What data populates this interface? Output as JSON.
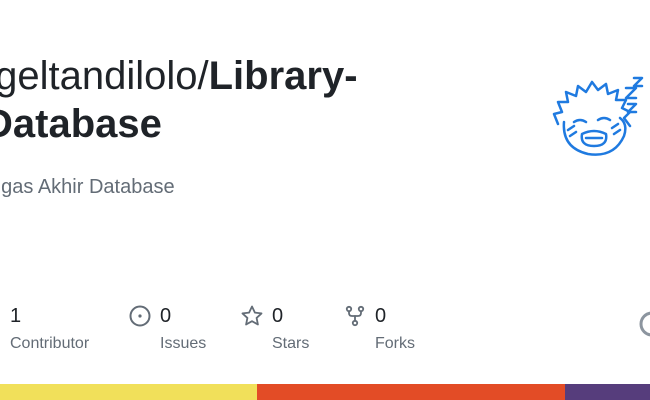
{
  "repo": {
    "owner": "Igeltandilolo",
    "separator": "/",
    "name_part1": "Library-",
    "name_part2": "Database",
    "description": "ugas Akhir Database"
  },
  "avatar": {
    "icon": "identicon-sleeping-face-icon",
    "color": "#1f7ae0"
  },
  "stats": [
    {
      "icon": "contributor-icon",
      "value": "1",
      "label": "Contributor"
    },
    {
      "icon": "issue-icon",
      "value": "0",
      "label": "Issues"
    },
    {
      "icon": "star-icon",
      "value": "0",
      "label": "Stars"
    },
    {
      "icon": "fork-icon",
      "value": "0",
      "label": "Forks"
    }
  ],
  "languages": [
    {
      "color": "#f1e05a",
      "percent": 39.5
    },
    {
      "color": "#e34c26",
      "percent": 47.4
    },
    {
      "color": "#563d7c",
      "percent": 13.1
    }
  ],
  "colors": {
    "text": "#1f2328",
    "muted": "#636c76",
    "icon": "#636c76"
  }
}
